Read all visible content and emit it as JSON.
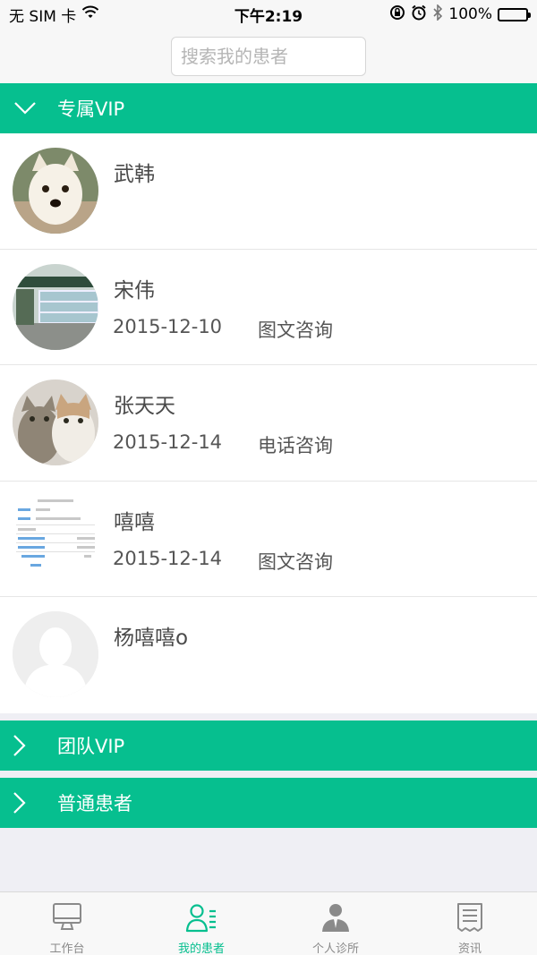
{
  "status_bar": {
    "carrier": "无 SIM 卡",
    "time": "下午2:19",
    "battery": "100%"
  },
  "search": {
    "placeholder": "搜索我的患者"
  },
  "groups": {
    "exclusive_vip": "专属VIP",
    "team_vip": "团队VIP",
    "regular": "普通患者"
  },
  "patients": [
    {
      "name": "武韩",
      "date": "",
      "service": ""
    },
    {
      "name": "宋伟",
      "date": "2015-12-10",
      "service": "图文咨询"
    },
    {
      "name": "张天天",
      "date": "2015-12-14",
      "service": "电话咨询"
    },
    {
      "name": "嘻嘻",
      "date": "2015-12-14",
      "service": "图文咨询"
    },
    {
      "name": "杨嘻嘻o",
      "date": "",
      "service": ""
    }
  ],
  "tab_bar": {
    "items": [
      {
        "label": "工作台",
        "icon": "monitor-icon"
      },
      {
        "label": "我的患者",
        "icon": "patients-icon"
      },
      {
        "label": "个人诊所",
        "icon": "doctor-icon"
      },
      {
        "label": "资讯",
        "icon": "news-icon"
      }
    ],
    "active_index": 1
  },
  "colors": {
    "accent": "#06bf8f",
    "tab_inactive": "#8a8a8a"
  }
}
